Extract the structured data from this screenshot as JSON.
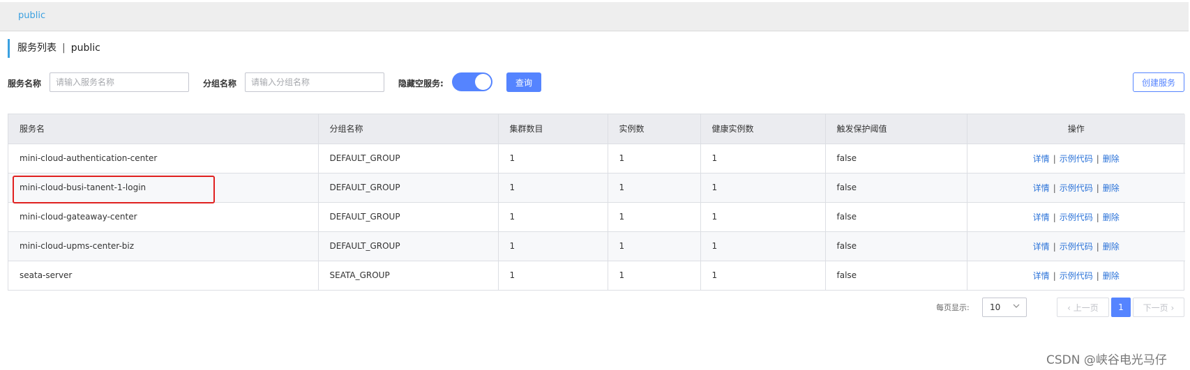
{
  "namespace_bar": {
    "active": "public"
  },
  "page_title": {
    "main": "服务列表",
    "separator": "|",
    "namespace": "public"
  },
  "filters": {
    "service_name_label": "服务名称",
    "service_name_placeholder": "请输入服务名称",
    "group_name_label": "分组名称",
    "group_name_placeholder": "请输入分组名称",
    "hide_empty_label": "隐藏空服务:",
    "hide_empty_on": true,
    "query_button": "查询",
    "create_button": "创建服务"
  },
  "table": {
    "columns": [
      "服务名",
      "分组名称",
      "集群数目",
      "实例数",
      "健康实例数",
      "触发保护阈值",
      "操作"
    ],
    "rows": [
      {
        "service": "mini-cloud-authentication-center",
        "group": "DEFAULT_GROUP",
        "clusters": "1",
        "instances": "1",
        "healthy": "1",
        "threshold": "false"
      },
      {
        "service": "mini-cloud-busi-tanent-1-login",
        "group": "DEFAULT_GROUP",
        "clusters": "1",
        "instances": "1",
        "healthy": "1",
        "threshold": "false"
      },
      {
        "service": "mini-cloud-gateaway-center",
        "group": "DEFAULT_GROUP",
        "clusters": "1",
        "instances": "1",
        "healthy": "1",
        "threshold": "false"
      },
      {
        "service": "mini-cloud-upms-center-biz",
        "group": "DEFAULT_GROUP",
        "clusters": "1",
        "instances": "1",
        "healthy": "1",
        "threshold": "false"
      },
      {
        "service": "seata-server",
        "group": "SEATA_GROUP",
        "clusters": "1",
        "instances": "1",
        "healthy": "1",
        "threshold": "false"
      }
    ],
    "actions": {
      "detail": "详情",
      "sample_code": "示例代码",
      "delete": "删除",
      "separator": "|"
    },
    "highlighted_row": 1,
    "highlight_color": "#e0201f"
  },
  "pagination": {
    "page_size_label": "每页显示:",
    "page_size": "10",
    "prev": "上一页",
    "next": "下一页",
    "current_page": "1"
  },
  "watermark": "CSDN @峡谷电光马仔",
  "colors": {
    "primary": "#5584ff",
    "link": "#2a72d8",
    "accent": "#3aa0e0"
  }
}
